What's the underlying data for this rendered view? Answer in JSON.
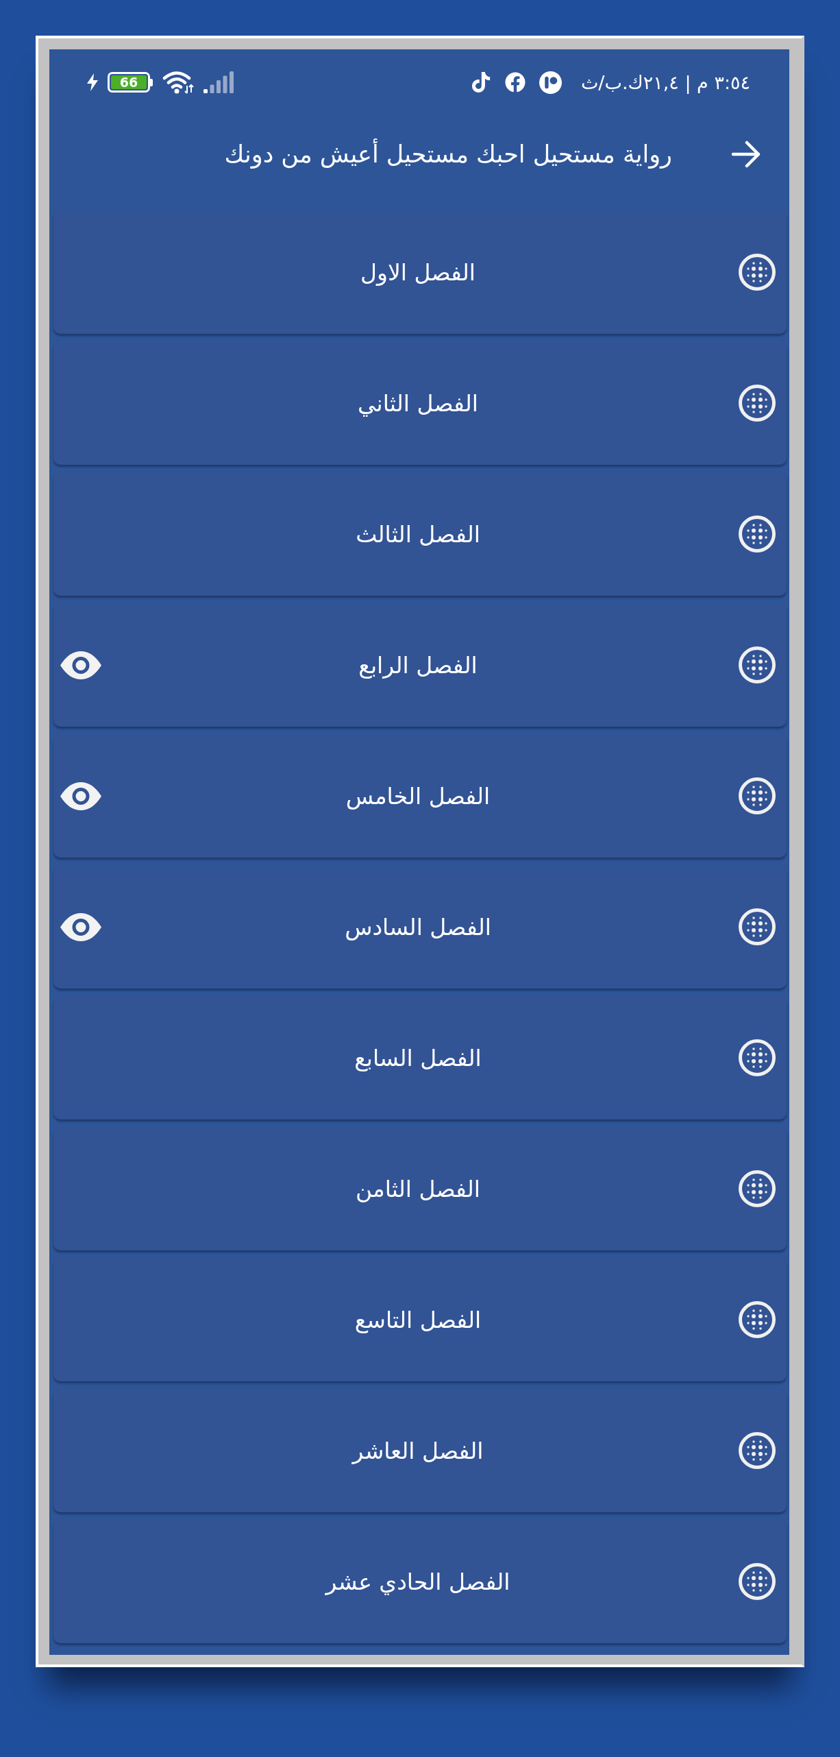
{
  "status_bar": {
    "time_speed": "٣:٥٤ م | ٢١,٤ك.ب/ث",
    "battery": "66"
  },
  "header": {
    "title": "رواية مستحيل احبك مستحيل أعيش من دونك"
  },
  "chapters": [
    {
      "title": "الفصل الاول",
      "seen": false
    },
    {
      "title": "الفصل الثاني",
      "seen": false
    },
    {
      "title": "الفصل الثالث",
      "seen": false
    },
    {
      "title": "الفصل الرابع",
      "seen": true
    },
    {
      "title": "الفصل الخامس",
      "seen": true
    },
    {
      "title": "الفصل السادس",
      "seen": true
    },
    {
      "title": "الفصل السابع",
      "seen": false
    },
    {
      "title": "الفصل الثامن",
      "seen": false
    },
    {
      "title": "الفصل التاسع",
      "seen": false
    },
    {
      "title": "الفصل العاشر",
      "seen": false
    },
    {
      "title": "الفصل الحادي عشر",
      "seen": false
    }
  ]
}
